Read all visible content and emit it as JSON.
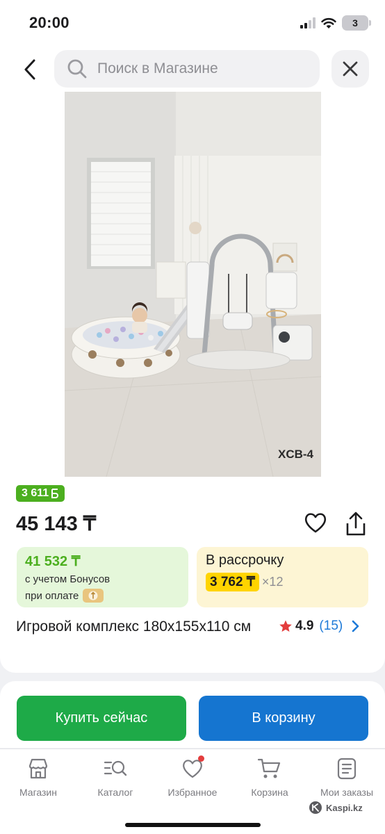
{
  "status_bar": {
    "time": "20:00",
    "battery": "3"
  },
  "search": {
    "placeholder": "Поиск в Магазине"
  },
  "product": {
    "image_label": "XCB-4",
    "bonus_badge": "3 611",
    "price": "45 143 ₸",
    "bonus_card": {
      "amount": "41 532 ₸",
      "line1": "с учетом Бонусов",
      "line2": "при оплате"
    },
    "installment_card": {
      "title": "В рассрочку",
      "monthly": "3 762 ₸",
      "months": "×12"
    },
    "title": "Игровой комплекс 180x155x110 см",
    "rating": {
      "value": "4.9",
      "count": "(15)"
    }
  },
  "actions": {
    "buy_now": "Купить сейчас",
    "add_to_cart": "В корзину"
  },
  "tab_bar": {
    "items": [
      {
        "label": "Магазин",
        "icon": "store-icon"
      },
      {
        "label": "Каталог",
        "icon": "catalog-search-icon"
      },
      {
        "label": "Избранное",
        "icon": "heart-icon"
      },
      {
        "label": "Корзина",
        "icon": "cart-icon"
      },
      {
        "label": "Мои заказы",
        "icon": "orders-icon"
      }
    ]
  },
  "watermark": "Kaspi.kz",
  "colors": {
    "bonus_green": "#4caf1f",
    "buy_green": "#1eaa48",
    "cart_blue": "#1575d0",
    "installment_yellow": "#ffd400",
    "rating_star": "#e33d3d"
  }
}
